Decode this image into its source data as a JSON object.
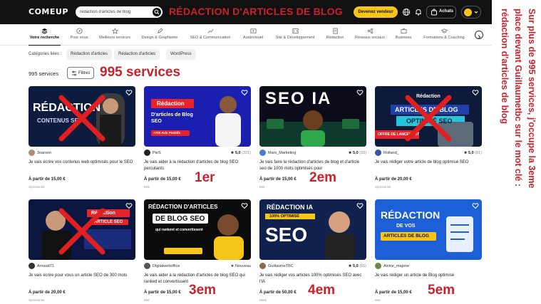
{
  "header": {
    "logo": "COMEUP",
    "search_value": "rédaction d'articles de blog",
    "overlay_title": "RÉDACTION D'ARTICLES DE BLOG",
    "vendor_button": "Devenez vendeur",
    "cart_label": "Achats"
  },
  "categories": [
    {
      "label": "Votre recherche",
      "icon": "layers-icon",
      "active": true
    },
    {
      "label": "Pour vous",
      "icon": "compass-icon"
    },
    {
      "label": "Meilleurs services",
      "icon": "star-icon"
    },
    {
      "label": "Design & Graphisme",
      "icon": "pen-icon"
    },
    {
      "label": "SEO & Communication",
      "icon": "chart-icon"
    },
    {
      "label": "Audiovisuel",
      "icon": "film-icon"
    },
    {
      "label": "Site & Développement",
      "icon": "code-icon"
    },
    {
      "label": "Rédaction",
      "icon": "doc-icon"
    },
    {
      "label": "Réseaux sociaux",
      "icon": "share-icon"
    },
    {
      "label": "Business",
      "icon": "briefcase-icon"
    },
    {
      "label": "Formations & Coaching",
      "icon": "graduation-icon"
    }
  ],
  "tags": {
    "label": "Catégories liées :",
    "items": [
      "Rédaction d'articles",
      "Rédaction d'articles",
      "WordPress"
    ]
  },
  "results": {
    "count": "995 services",
    "filters_label": "Filtres",
    "overlay_count": "995 services"
  },
  "cards": [
    {
      "seller": "3oarson",
      "rating": "",
      "reviews": "",
      "badge": "",
      "desc": "Je vais écrire vos contenus web optimisés pour le SEO",
      "price": "À partir de 15,00 €",
      "sub": "Sponsorisé",
      "thumb_title": "RÉDACTION",
      "thumb_sub": "CONTENUS SEO",
      "crossed": true
    },
    {
      "seller": "PieS",
      "rating": "★ 5,0",
      "reviews": "(221)",
      "badge": "",
      "desc": "Je vais aider à la rédaction d'articles de blog SEO percutants",
      "price": "À partir de 15,00 €",
      "sub": "€€€",
      "thumb_title": "Rédaction",
      "thumb_sub": "D'articles de Blog SEO",
      "thumb_extra": "+700 Avis Positifs",
      "crossed": false
    },
    {
      "seller": "Marx_Marketing",
      "rating": "★ 5,0",
      "reviews": "(33)",
      "badge": "",
      "desc": "Je vais faire la rédaction d'articles de blog et d'article seo de 1000 mots optimisés pour",
      "price": "À partir de 15,00 €",
      "sub": "€€€",
      "thumb_title": "SEO IA",
      "crossed": false
    },
    {
      "seller": "Rolland_",
      "rating": "★ 5,0",
      "reviews": "(81)",
      "badge": "",
      "desc": "Je vais rédiger votre article de blog optimisé SEO",
      "price": "À partir de 20,00 €",
      "sub": "Sponsorisé",
      "thumb_title": "Rédaction",
      "thumb_sub": "ARTICLES DE BLOG",
      "thumb_extra": "OPTIMISÉ SEO",
      "thumb_tag": "OFFRE DE LANCEMENT",
      "crossed": true
    },
    {
      "seller": "Arnaud71",
      "rating": "",
      "reviews": "",
      "badge": "",
      "desc": "Je vais écrire pour vous un article SEO de 300 mots",
      "price": "À partir de 20,00 €",
      "sub": "Sponsorisé",
      "thumb_title": "Rédaction",
      "thumb_sub": "ARTICLE SEO",
      "crossed": true
    },
    {
      "seller": "Digitalweboffice",
      "rating": "",
      "reviews": "",
      "badge": "★ Nouveau",
      "desc": "Je vais aider à la rédaction d'articles de blog SEO qui ranked et convertissent",
      "price": "À partir de 15,00 €",
      "sub": "€€€",
      "thumb_title": "RÉDACTION D'ARTICLES",
      "thumb_sub": "DE BLOG SEO",
      "thumb_extra": "qui rankent et convertissent",
      "crossed": false
    },
    {
      "seller": "GuillaumeTBC",
      "rating": "★ 5,0",
      "reviews": "(65)",
      "badge": "",
      "desc": "Je vais rédiger vos articles 100% optimisés SEO avec l'IA",
      "price": "À partir de 50,00 €",
      "sub": "€€€€",
      "thumb_title": "RÉDACTION IA",
      "thumb_sub": "100% OPTIMISÉ",
      "thumb_extra": "SEO",
      "crossed": false
    },
    {
      "seller": "Aivine_majone",
      "rating": "",
      "reviews": "",
      "badge": "",
      "desc": "Je vais rédiger un article de Blog optimisé",
      "price": "À partir de 15,00 €",
      "sub": "€€€",
      "thumb_title": "RÉDACTION",
      "thumb_sub": "DE VOS",
      "thumb_extra": "ARTICLES DE BLOG",
      "crossed": false
    }
  ],
  "annotations": {
    "rank_1": "1er",
    "rank_2": "2em",
    "rank_3": "3em",
    "rank_4": "4em",
    "rank_5": "5em",
    "vertical_lines": [
      "Sur plus de 995 services, j'occupe la 3eme",
      "place devant Guillaumetbc sur le mot clé :",
      "rédaction d'articles de blog"
    ]
  },
  "colors": {
    "annotation_red": "#c8232c",
    "header_bg": "#111111",
    "vendor_yellow": "#f5c518"
  }
}
